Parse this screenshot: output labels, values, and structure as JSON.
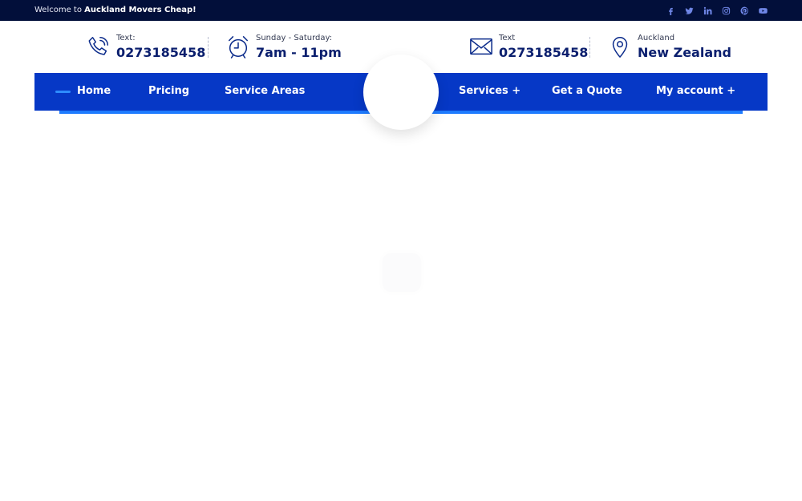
{
  "topbar": {
    "welcome_prefix": "Welcome to",
    "welcome_brand": "Auckland Movers Cheap!",
    "socials": [
      "facebook-icon",
      "twitter-icon",
      "linkedin-icon",
      "instagram-icon",
      "pinterest-icon",
      "youtube-icon"
    ]
  },
  "info": {
    "phone1": {
      "label": "Text:",
      "value": "0273185458",
      "icon": "phone-icon"
    },
    "hours": {
      "label": "Sunday - Saturday:",
      "value": "7am - 11pm",
      "icon": "alarm-clock-icon"
    },
    "phone2": {
      "label": "Text",
      "value": "0273185458",
      "icon": "envelope-icon"
    },
    "location": {
      "label": "Auckland",
      "value": "New Zealand",
      "icon": "map-pin-icon"
    }
  },
  "nav": {
    "home": "Home",
    "pricing": "Pricing",
    "service_areas": "Service Areas",
    "services": "Services +",
    "quote": "Get a Quote",
    "account": "My account +"
  },
  "colors": {
    "topbar_bg": "#020f3a",
    "nav_bg": "#0638c6",
    "nav_accent": "#1e7bff",
    "text_dark": "#0b1f6e"
  }
}
